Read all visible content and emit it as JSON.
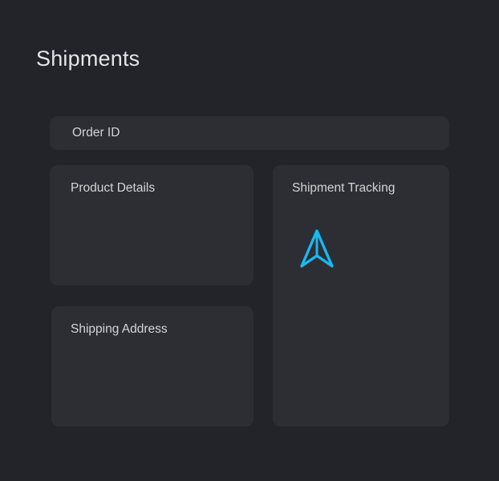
{
  "header": {
    "title": "Shipments"
  },
  "order": {
    "label": "Order ID"
  },
  "product": {
    "title": "Product Details"
  },
  "address": {
    "title": "Shipping Address"
  },
  "tracking": {
    "title": "Shipment Tracking",
    "icon": "navigation-arrow-icon",
    "icon_color": "#1ab8f0"
  },
  "colors": {
    "background": "#222429",
    "card": "#2c2e33",
    "text": "#d3d4d8",
    "accent": "#1ab8f0"
  }
}
